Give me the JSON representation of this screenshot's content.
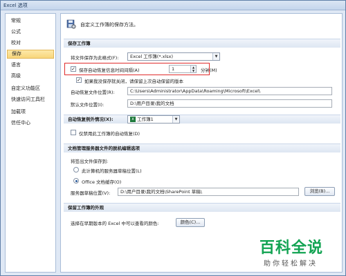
{
  "window": {
    "title": "Excel 选项"
  },
  "sidebar": {
    "items": [
      {
        "label": "常规"
      },
      {
        "label": "公式"
      },
      {
        "label": "校对"
      },
      {
        "label": "保存"
      },
      {
        "label": "语言"
      },
      {
        "label": "高级"
      },
      {
        "label": "自定义功能区"
      },
      {
        "label": "快速访问工具栏"
      },
      {
        "label": "加载项"
      },
      {
        "label": "信任中心"
      }
    ],
    "active": "保存"
  },
  "header": {
    "text": "自定义工作簿的保存方法。",
    "icon": "floppy-gear-icon"
  },
  "save_workbooks": {
    "section_title": "保存工作簿",
    "format_label": "将文件保存为此格式(F):",
    "format_value": "Excel 工作簿(*.xlsx)",
    "autorecover_label": "保存自动恢复信息时间间隔(A)",
    "autorecover_checked": true,
    "autorecover_minutes": "1",
    "minutes_label": "分钟(M)",
    "keep_last_label": "如果我没保存就关闭，请保留上次自动保留的版本",
    "keep_last_checked": true,
    "autorecover_location_label": "自动恢复文件位置(R):",
    "autorecover_location_value": "C:\\Users\\Administrator\\AppData\\Roaming\\Microsoft\\Excel\\",
    "default_location_label": "默认文件位置(I):",
    "default_location_value": "D:\\用户目录\\我的文档"
  },
  "autorecover_exceptions": {
    "section_title": "自动恢复例外情况(X):",
    "workbook_value": "工作簿1",
    "disable_label": "仅禁用此工作簿的自动恢复(D)",
    "disable_checked": false
  },
  "offline_editing": {
    "section_title": "文档管理服务器文件的脱机编辑选项",
    "save_to_label": "将签出文件保存到:",
    "option_server": "此计算机的服务器草稿位置(L)",
    "option_office": "Office 文档缓存(O)",
    "selected": "Office 文档缓存(O)",
    "drafts_label": "服务器草稿位置(V):",
    "drafts_value": "D:\\用户目录\\我的文档\\SharePoint 草稿\\",
    "browse_label": "浏览(B)..."
  },
  "preserve_visual": {
    "section_title": "保留工作簿的外观",
    "colors_label": "选择在早期版本的 Excel 中可以查看的颜色:",
    "colors_button": "颜色(C)..."
  },
  "watermark": {
    "main": "百科全说",
    "sub": "助你轻松解决"
  },
  "colors": {
    "accent_green": "#12a352",
    "highlight_red": "#e02b2b",
    "active_tab": "#f8d57b"
  }
}
